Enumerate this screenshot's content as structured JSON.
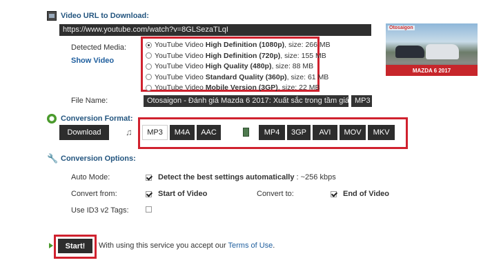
{
  "video_url": {
    "title": "Video URL to Download:",
    "value": "https://www.youtube.com/watch?v=8GLSezaTLqI"
  },
  "detected_media": {
    "label": "Detected Media:",
    "show_video_link": "Show Video",
    "options": [
      {
        "prefix": "YouTube Video ",
        "bold": "High Definition (1080p)",
        "suffix": ", size: 266 MB",
        "checked": true
      },
      {
        "prefix": "YouTube Video ",
        "bold": "High Definition (720p)",
        "suffix": ", size: 155 MB",
        "checked": false
      },
      {
        "prefix": "YouTube Video ",
        "bold": "High Quality (480p)",
        "suffix": ", size: 88 MB",
        "checked": false
      },
      {
        "prefix": "YouTube Video ",
        "bold": "Standard Quality (360p)",
        "suffix": ", size: 61 MB",
        "checked": false
      },
      {
        "prefix": "YouTube Video ",
        "bold": "Mobile Version (3GP)",
        "suffix": ", size: 22 MB",
        "checked": false
      }
    ]
  },
  "thumbnail": {
    "logo_text": "Otosaigon",
    "caption": "MAZDA 6 2017"
  },
  "file_name": {
    "label": "File Name:",
    "value": "Otosaigon - Đánh giá Mazda 6 2017: Xuất sắc trong tầm giá",
    "extension": "MP3"
  },
  "conversion_format": {
    "title": "Conversion Format:",
    "download_button": "Download",
    "audio_formats": [
      "MP3",
      "M4A",
      "AAC"
    ],
    "selected_audio": "MP3",
    "video_formats": [
      "MP4",
      "3GP",
      "AVI",
      "MOV",
      "MKV"
    ]
  },
  "conversion_options": {
    "title": "Conversion Options:",
    "auto_mode_label": "Auto Mode:",
    "auto_mode_text_bold": "Detect the best settings automatically",
    "auto_mode_text_rest": " : ~256 kbps",
    "auto_mode_checked": true,
    "convert_from_label": "Convert from:",
    "convert_from_value": "Start of Video",
    "convert_from_checked": true,
    "convert_to_label": "Convert to:",
    "convert_to_value": "End of Video",
    "convert_to_checked": true,
    "id3_label": "Use ID3 v2 Tags:",
    "id3_checked": false
  },
  "start": {
    "button_label": "Start!",
    "terms_text": "With using this service you accept our ",
    "terms_link": "Terms of Use",
    "terms_end": "."
  },
  "colors": {
    "accent_blue": "#23557f",
    "highlight_red": "#d0212e",
    "dark_button": "#2d2d2d"
  }
}
